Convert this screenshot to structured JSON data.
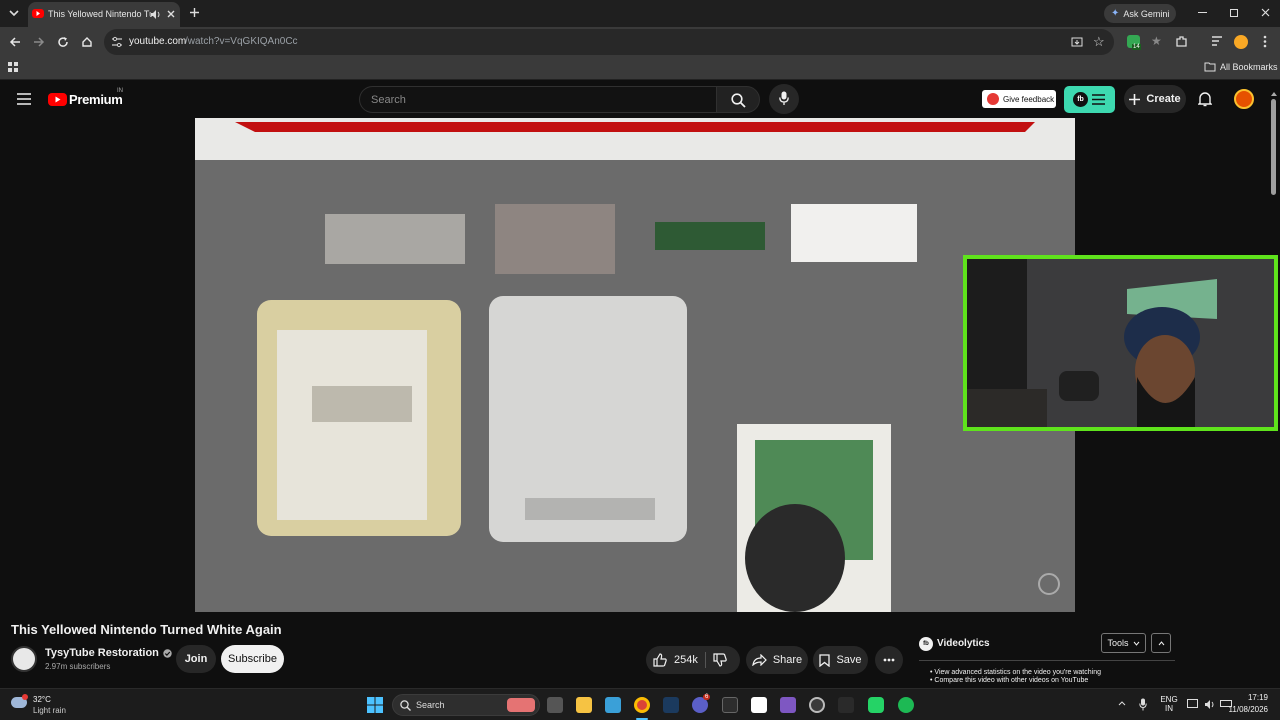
{
  "browser": {
    "tab_title": "This Yellowed Nintendo Tu",
    "url_domain": "youtube.com",
    "url_path": "/watch?v=VqGKIQAn0Cc",
    "ask_gemini": "Ask Gemini",
    "bookmarks_label": "All Bookmarks",
    "extension_badge": "14",
    "accent": "#8ab4f8"
  },
  "youtube": {
    "logo_text": "Premium",
    "logo_region": "IN",
    "search_placeholder": "Search",
    "give_feedback": "Give feedback",
    "create_label": "Create",
    "brand_red": "#ff0000",
    "video_title": "This Yellowed Nintendo Turned White Again",
    "channel_name": "TysyTube Restoration",
    "subscribers": "2.97m subscribers",
    "join_label": "Join",
    "subscribe_label": "Subscribe",
    "likes": "254k",
    "share_label": "Share",
    "save_label": "Save"
  },
  "videolytics": {
    "title": "Videolytics",
    "tools_label": "Tools",
    "bullets": [
      "View advanced statistics on the video you're watching",
      "Compare this video with other videos on YouTube"
    ]
  },
  "taskbar": {
    "weather_temp": "32°C",
    "weather_desc": "Light rain",
    "search_label": "Search",
    "lang_top": "ENG",
    "lang_bottom": "IN",
    "time": "17:19",
    "date": "11/08/2026",
    "teams_badge": "6"
  }
}
